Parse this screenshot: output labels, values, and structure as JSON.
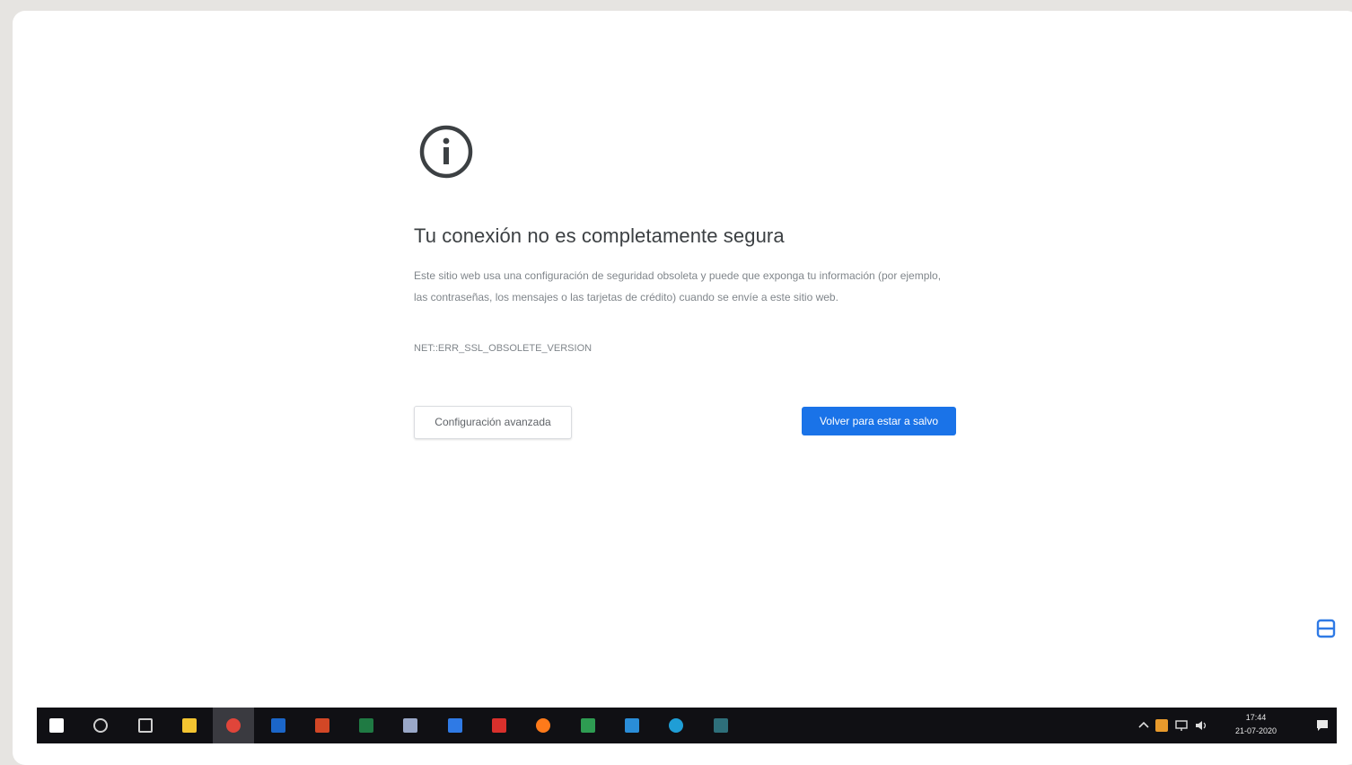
{
  "page": {
    "title": "Tu conexión no es completamente segura",
    "description": "Este sitio web usa una configuración de seguridad obsoleta y puede que exponga tu información (por ejemplo, las contraseñas, los mensajes o las tarjetas de crédito) cuando se envíe a este sitio web.",
    "error_code": "NET::ERR_SSL_OBSOLETE_VERSION",
    "advanced_button": "Configuración avanzada",
    "back_button": "Volver para estar a salvo"
  },
  "icons": {
    "main": "info-icon",
    "side_widget": "screenshot-capture-icon"
  },
  "taskbar": {
    "items": [
      {
        "name": "windows-start-icon",
        "color": "#ffffff"
      },
      {
        "name": "search-icon",
        "color": "#cfcfcf"
      },
      {
        "name": "task-view-icon",
        "color": "#cfcfcf"
      },
      {
        "name": "file-explorer-icon",
        "color": "#f3c431"
      },
      {
        "name": "chrome-icon",
        "color": "#e0453a"
      },
      {
        "name": "outlook-icon",
        "color": "#1b66c9"
      },
      {
        "name": "powerpoint-icon",
        "color": "#d24726"
      },
      {
        "name": "excel-icon",
        "color": "#1f7a43"
      },
      {
        "name": "dropbox-icon",
        "color": "#9aa8c8"
      },
      {
        "name": "word-icon",
        "color": "#2f7ae5"
      },
      {
        "name": "acrobat-icon",
        "color": "#d9302c"
      },
      {
        "name": "firefox-icon",
        "color": "#ff7a1a"
      },
      {
        "name": "sheets-app-icon",
        "color": "#2e9c52"
      },
      {
        "name": "vscode-icon",
        "color": "#2a8dd8"
      },
      {
        "name": "edge-icon",
        "color": "#1f9ed6"
      },
      {
        "name": "terminal-app-icon",
        "color": "#2e6f7a"
      }
    ],
    "clock_time": "17:44",
    "clock_date": "21-07-2020"
  },
  "colors": {
    "accent": "#1a73e8",
    "taskbar": "#101014"
  }
}
